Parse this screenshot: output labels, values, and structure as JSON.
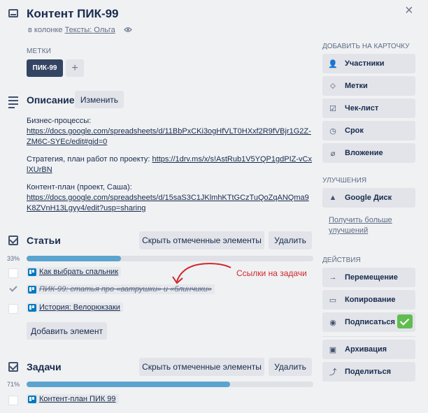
{
  "header": {
    "title": "Контент ПИК-99",
    "in_list_prefix": "в колонке",
    "list_name": "Тексты: Ольга",
    "close": "×"
  },
  "labels": {
    "heading": "МЕТКИ",
    "chip": "ПИК-99",
    "add": "+"
  },
  "description": {
    "heading": "Описание",
    "edit_label": "Изменить",
    "p1_text": "Бизнес-процессы:",
    "p1_link": "https://docs.google.com/spreadsheets/d/11BbPxCKi3ogHfVLT0HXxf2R9fVBjr1G2Z-ZM6C-SYEc/edit#gid=0",
    "p2_text": "Стратегия, план работ по проекту: ",
    "p2_link": "https://1drv.ms/x/s!AstRub1V5YQP1gdPIZ-vCxlXUrBN",
    "p3_text": "Контент-план (проект, Саша):",
    "p3_link": "https://docs.google.com/spreadsheets/d/15saS3C1JKlmhKTtGCzTuQoZqANQma9K8ZVnH13Lgyy4/edit?usp=sharing"
  },
  "checklist1": {
    "heading": "Статьи",
    "hide_label": "Скрыть отмеченные элементы",
    "delete_label": "Удалить",
    "percent_text": "33%",
    "progress": 0.33,
    "items": [
      {
        "text": "Как выбрать спальник",
        "done": false
      },
      {
        "text": "ПИК-99: статья про «ватрушки» и «блинчики»",
        "done": true
      },
      {
        "text": "История: Велорюкзаки",
        "done": false
      }
    ],
    "add_label": "Добавить элемент"
  },
  "checklist2": {
    "heading": "Задачи",
    "hide_label": "Скрыть отмеченные элементы",
    "delete_label": "Удалить",
    "percent_text": "71%",
    "progress": 0.71,
    "items": [
      {
        "text": "Контент-план ПИК 99",
        "done": false
      }
    ]
  },
  "annotation": {
    "text": "Ссылки на задачи",
    "color": "#d0262b"
  },
  "sidebar": {
    "add_heading": "ДОБАВИТЬ НА КАРТОЧКУ",
    "members": "Участники",
    "labels": "Метки",
    "checklist": "Чек-лист",
    "due": "Срок",
    "attachment": "Вложение",
    "powerups_heading": "УЛУЧШЕНИЯ",
    "google_drive": "Google Диск",
    "more_powerups": "Получить больше улучшений",
    "actions_heading": "ДЕЙСТВИЯ",
    "move": "Перемещение",
    "copy": "Копирование",
    "subscribe": "Подписаться",
    "archive": "Архивация",
    "share": "Поделиться"
  }
}
